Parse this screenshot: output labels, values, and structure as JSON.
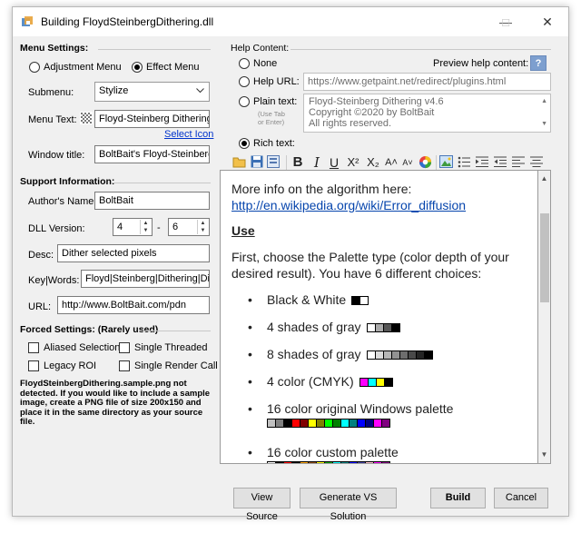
{
  "window": {
    "title": "Building FloydSteinbergDithering.dll",
    "min_glyph": "—",
    "max_glyph": "☐",
    "close_glyph": "✕"
  },
  "menu_settings": {
    "group_label": "Menu Settings:",
    "adjustment_label": "Adjustment Menu",
    "effect_label": "Effect Menu",
    "selected": "effect",
    "submenu_label": "Submenu:",
    "submenu_value": "Stylize",
    "menu_text_label": "Menu Text:",
    "menu_text_value": "Floyd-Steinberg Dithering",
    "select_icon_link": "Select Icon",
    "window_title_label": "Window title:",
    "window_title_value": "BoltBait's Floyd-Steinberg D"
  },
  "support_info": {
    "group_label": "Support Information:",
    "author_label": "Author's Name:",
    "author_value": "BoltBait",
    "dll_version_label": "DLL Version:",
    "version_major": "4",
    "version_dash": "-",
    "version_minor": "6",
    "desc_label": "Desc:",
    "desc_value": "Dither selected pixels",
    "keywords_label": "Key|Words:",
    "keywords_value": "Floyd|Steinberg|Dithering|Dithe",
    "url_label": "URL:",
    "url_value": "http://www.BoltBait.com/pdn"
  },
  "forced_settings": {
    "group_label": "Forced Settings: (Rarely used)",
    "aliased_selection": "Aliased Selection",
    "single_threaded": "Single Threaded",
    "legacy_roi": "Legacy ROI",
    "single_render_call": "Single Render Call"
  },
  "warning_lines": [
    "FloydSteinbergDithering.sample.png not",
    "detected.  If you would like to include a sample",
    "image, create a PNG file of size 200x150 and",
    "place it in the same directory as your source",
    "file."
  ],
  "help_content": {
    "group_label": "Help Content:",
    "none_label": "None",
    "preview_label": "Preview help content:",
    "preview_icon_glyph": "?",
    "help_url_label": "Help URL:",
    "help_url_value": "https://www.getpaint.net/redirect/plugins.html",
    "plain_text_label": "Plain text:",
    "plain_text_hint_1": "(Use Tab",
    "plain_text_hint_2": "or Enter)",
    "plain_text_lines": [
      "Floyd-Steinberg Dithering v4.6",
      "Copyright ©2020 by BoltBait",
      "All rights reserved."
    ],
    "rich_text_label": "Rich text:",
    "selected": "rich"
  },
  "toolbar": {
    "bold": "B",
    "italic": "I",
    "underline": "U",
    "superscript": "X²",
    "subscript": "X₂",
    "grow": "A˄",
    "shrink": "A˅"
  },
  "rich_text": {
    "line1": "More info on the algorithm here:",
    "link": "http://en.wikipedia.org/wiki/Error_diffusion",
    "heading": "Use",
    "para1": "First, choose the Palette type (color depth of your",
    "para2": "desired result).  You have 6 different choices:",
    "bullet_glyph": "•",
    "bullets": [
      "Black & White",
      "4 shades of gray",
      "8 shades of gray",
      "4 color (CMYK)",
      "16 color original Windows palette",
      "16 color custom palette"
    ],
    "swatches": {
      "bw": [
        "#000000",
        "#ffffff"
      ],
      "gray4": [
        "#ffffff",
        "#aaaaaa",
        "#555555",
        "#000000"
      ],
      "gray8": [
        "#ffffff",
        "#dbdbdb",
        "#b6b6b6",
        "#929292",
        "#6d6d6d",
        "#494949",
        "#242424",
        "#000000"
      ],
      "cmyk": [
        "#ff00ff",
        "#00ffff",
        "#ffff00",
        "#000000"
      ],
      "win16": [
        "#c0c0c0",
        "#808080",
        "#000000",
        "#ff0000",
        "#800000",
        "#ffff00",
        "#808000",
        "#00ff00",
        "#008000",
        "#00ffff",
        "#008080",
        "#0000ff",
        "#000080",
        "#ff00ff",
        "#800080"
      ],
      "custom16": [
        "#ffffff",
        "#000000",
        "#ff0000",
        "#000000",
        "#ffa500",
        "#8b4513",
        "#ffff00",
        "#00a000",
        "#00ffff",
        "#008080",
        "#0000ff",
        "#4040a0",
        "#ffc0cb",
        "#ff00ff",
        "#800080"
      ]
    }
  },
  "buttons": {
    "view_source": "View Source",
    "generate_vs": "Generate VS Solution",
    "build": "Build",
    "cancel": "Cancel"
  }
}
